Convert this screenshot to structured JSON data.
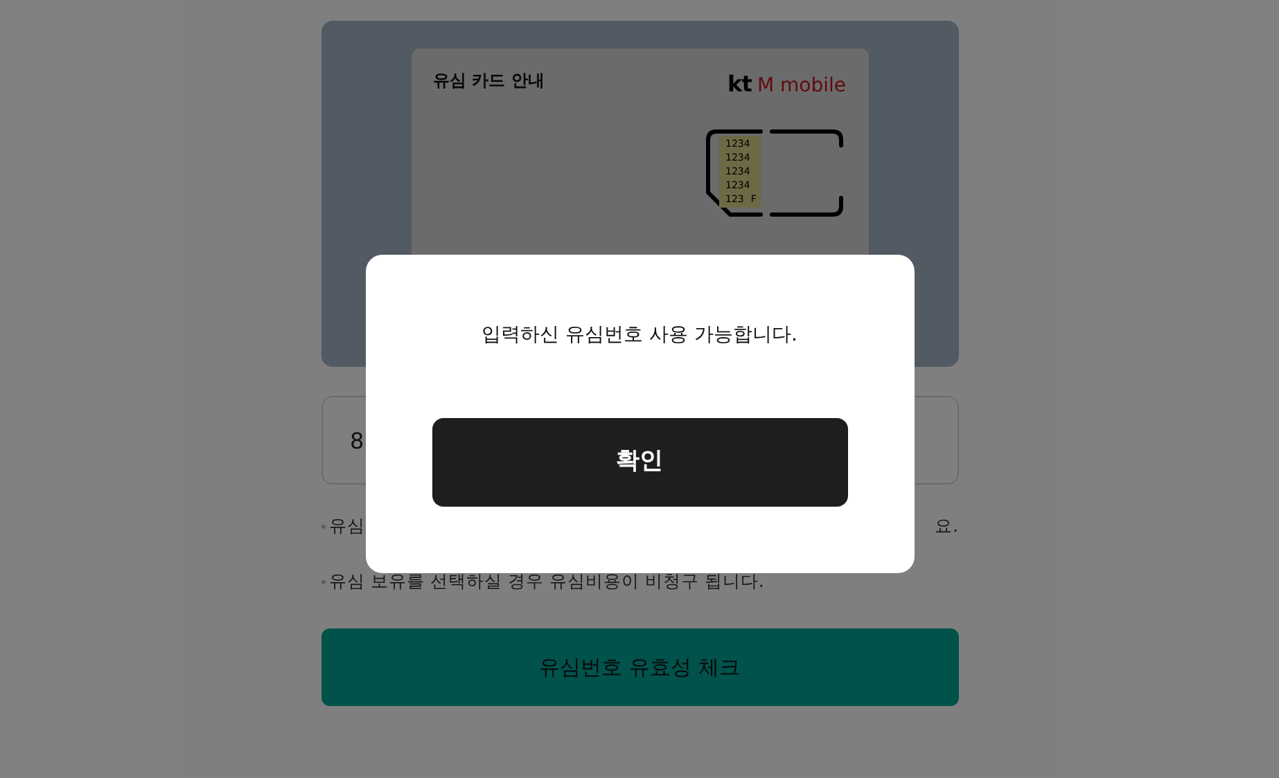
{
  "sim_card": {
    "title": "유심 카드 안내",
    "logo_mark": "kt",
    "logo_name": "M mobile",
    "numbers": [
      "1234",
      "1234",
      "1234",
      "1234",
      "123"
    ],
    "suffix": "F"
  },
  "sim_field": {
    "value": "8"
  },
  "notes": [
    {
      "left": "유심",
      "right": "요."
    },
    {
      "left": "유심 보유를 선택하실 경우 유심비용이 비청구 됩니다."
    }
  ],
  "check_button": "유심번호 유효성 체크",
  "dialog": {
    "message": "입력하신 유심번호 사용 가능합니다.",
    "button": "확인"
  }
}
